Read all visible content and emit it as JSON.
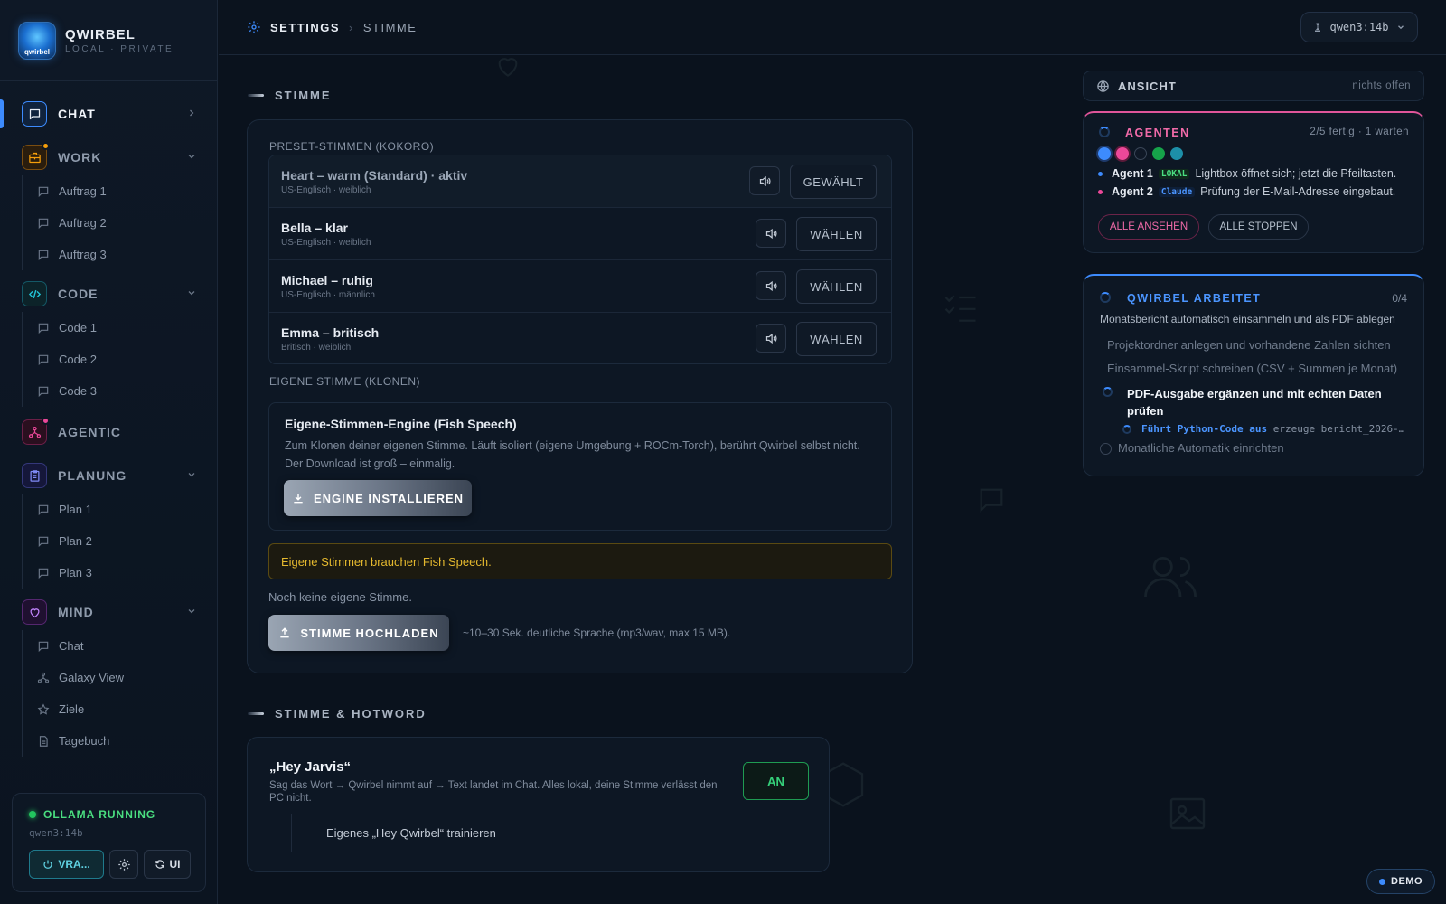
{
  "brand": {
    "name": "QWIRBEL",
    "subtitle": "LOCAL · PRIVATE",
    "logo_text": "qwirbel"
  },
  "sidebar": {
    "sections": [
      {
        "label": "CHAT",
        "icon": "message-square-icon",
        "color": "#3d8bfd",
        "active": true
      },
      {
        "label": "WORK",
        "icon": "briefcase-icon",
        "color": "#f59e0b",
        "items": [
          "Auftrag 1",
          "Auftrag 2",
          "Auftrag 3"
        ]
      },
      {
        "label": "CODE",
        "icon": "code-icon",
        "color": "#22c3d6",
        "items": [
          "Code 1",
          "Code 2",
          "Code 3"
        ]
      },
      {
        "label": "AGENTIC",
        "icon": "network-icon",
        "color": "#ec4899"
      },
      {
        "label": "PLANUNG",
        "icon": "clipboard-icon",
        "color": "#6366f1",
        "items": [
          "Plan 1",
          "Plan 2",
          "Plan 3"
        ]
      },
      {
        "label": "MIND",
        "icon": "heart-icon",
        "color": "#a855f7",
        "items": [
          "Chat",
          "Galaxy View",
          "Ziele",
          "Tagebuch"
        ]
      }
    ],
    "status": {
      "title": "OLLAMA RUNNING",
      "model": "qwen3:14b",
      "vram_label": "VRA...",
      "ui_label": "UI"
    }
  },
  "topbar": {
    "crumb_root": "SETTINGS",
    "crumb_page": "STIMME",
    "model": "qwen3:14b"
  },
  "main": {
    "section1_title": "STIMME",
    "preset_label": "PRESET-STIMMEN (KOKORO)",
    "voices": [
      {
        "name": "Heart – warm (Standard) · aktiv",
        "meta": "US-Englisch · weiblich",
        "button": "GEWÄHLT",
        "selected": true
      },
      {
        "name": "Bella – klar",
        "meta": "US-Englisch · weiblich",
        "button": "WÄHLEN"
      },
      {
        "name": "Michael – ruhig",
        "meta": "US-Englisch · männlich",
        "button": "WÄHLEN"
      },
      {
        "name": "Emma – britisch",
        "meta": "Britisch · weiblich",
        "button": "WÄHLEN"
      }
    ],
    "clone_label": "EIGENE STIMME (KLONEN)",
    "engine": {
      "title": "Eigene-Stimmen-Engine (Fish Speech)",
      "desc": "Zum Klonen deiner eigenen Stimme. Läuft isoliert (eigene Umgebung + ROCm-Torch), berührt Qwirbel selbst nicht. Der Download ist groß – einmalig.",
      "button": "ENGINE INSTALLIEREN"
    },
    "warning": "Eigene Stimmen brauchen Fish Speech.",
    "no_voice": "Noch keine eigene Stimme.",
    "upload_button": "STIMME HOCHLADEN",
    "upload_hint": "~10–30 Sek. deutliche Sprache (mp3/wav, max 15 MB).",
    "section2_title": "STIMME & HOTWORD",
    "hotword": {
      "title": "„Hey Jarvis“",
      "desc": "Sag das Wort → Qwirbel nimmt auf → Text landet im Chat. Alles lokal, deine Stimme verlässt den PC nicht.",
      "toggle": "AN",
      "train": "Eigenes „Hey Qwirbel“ trainieren"
    }
  },
  "right": {
    "ansicht_title": "ANSICHT",
    "ansicht_status": "nichts offen",
    "agents": {
      "title": "AGENTEN",
      "count": "2/5 fertig · 1 warten",
      "dot_colors": [
        "#3d8bfd",
        "#ec4899",
        "#1a2433",
        "#16a34a",
        "#1d8fa8"
      ],
      "lines": [
        {
          "agent": "Agent 1",
          "tag": "LOKAL",
          "tag_color": "#4ade80",
          "dot": "#3d8bfd",
          "text": "Lightbox öffnet sich; jetzt die Pfeiltasten."
        },
        {
          "agent": "Agent 2",
          "tag": "Claude",
          "tag_color": "#4b95ff",
          "dot": "#ec4899",
          "text": "Prüfung der E-Mail-Adresse eingebaut."
        }
      ],
      "view_all": "ALLE ANSEHEN",
      "stop_all": "ALLE STOPPEN"
    },
    "worker": {
      "title": "QWIRBEL ARBEITET",
      "count": "0/4",
      "goal": "Monatsbericht automatisch einsammeln und als PDF ablegen",
      "steps_done": [
        "Projektordner anlegen und vorhandene Zahlen sichten",
        "Einsammel-Skript schreiben (CSV + Summen je Monat)"
      ],
      "current": "PDF-Ausgabe ergänzen und mit echten Daten prüfen",
      "tool_label": "Führt Python-Code aus",
      "tool_arg": "erzeuge bericht_2026-…",
      "pending": "Monatliche Automatik einrichten"
    },
    "demo": "DEMO"
  }
}
